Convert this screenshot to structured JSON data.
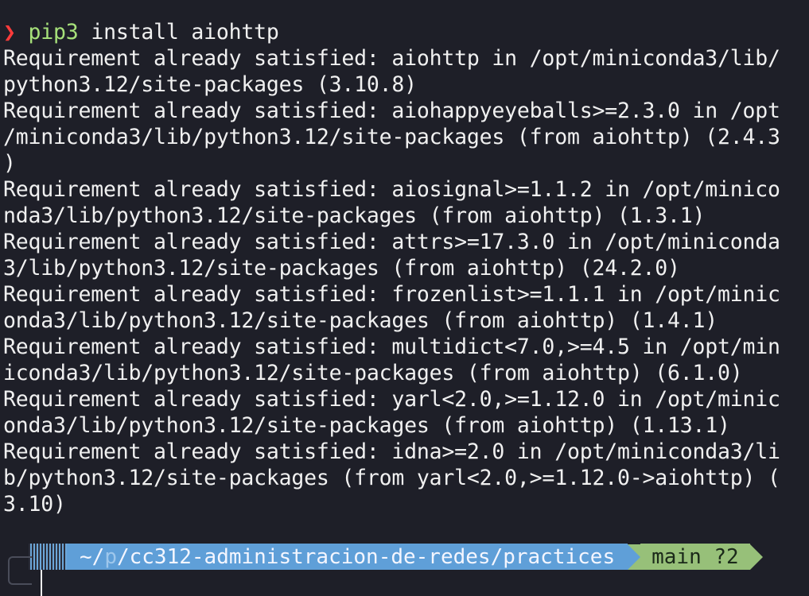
{
  "terminal": {
    "prompt_symbol": "❯",
    "command": "pip3",
    "args": " install aiohttp",
    "output_lines": [
      "Requirement already satisfied: aiohttp in /opt/miniconda3/lib/",
      "python3.12/site-packages (3.10.8)",
      "Requirement already satisfied: aiohappyeyeballs>=2.3.0 in /opt",
      "/miniconda3/lib/python3.12/site-packages (from aiohttp) (2.4.3",
      ")",
      "Requirement already satisfied: aiosignal>=1.1.2 in /opt/minico",
      "nda3/lib/python3.12/site-packages (from aiohttp) (1.3.1)",
      "Requirement already satisfied: attrs>=17.3.0 in /opt/miniconda",
      "3/lib/python3.12/site-packages (from aiohttp) (24.2.0)",
      "Requirement already satisfied: frozenlist>=1.1.1 in /opt/minic",
      "onda3/lib/python3.12/site-packages (from aiohttp) (1.4.1)",
      "Requirement already satisfied: multidict<7.0,>=4.5 in /opt/min",
      "iconda3/lib/python3.12/site-packages (from aiohttp) (6.1.0)",
      "Requirement already satisfied: yarl<2.0,>=1.12.0 in /opt/minic",
      "onda3/lib/python3.12/site-packages (from aiohttp) (1.13.1)",
      "Requirement already satisfied: idna>=2.0 in /opt/miniconda3/li",
      "b/python3.12/site-packages (from yarl<2.0,>=1.12.0->aiohttp) (",
      "3.10)"
    ]
  },
  "statusbar": {
    "path_home": "~/",
    "path_dim": "p",
    "path_rest": "/cc312-administracion-de-redes/practices",
    "git_branch": "main ?2"
  },
  "colors": {
    "background": "#1e1f28",
    "prompt": "#ff3b3b",
    "command": "#a6e07a",
    "path_segment": "#5f9fd8",
    "git_segment": "#97c079"
  }
}
